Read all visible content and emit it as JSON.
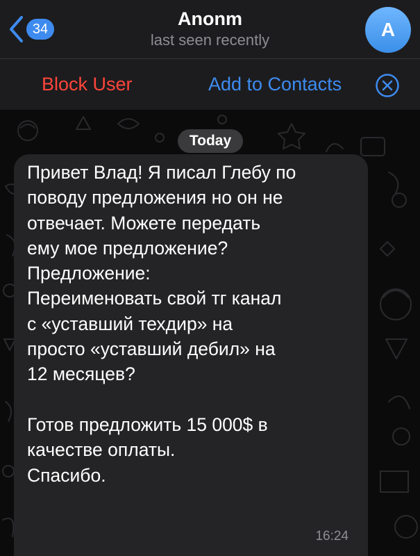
{
  "header": {
    "back_icon": "chevron-left-icon",
    "unread_count": "34",
    "title": "Anonm",
    "status": "last seen recently",
    "avatar_letter": "A"
  },
  "action_bar": {
    "block_label": "Block User",
    "add_label": "Add to Contacts",
    "close_icon": "close-circle-icon"
  },
  "chat": {
    "date_label": "Today",
    "messages": [
      {
        "text": "Привет Влад! Я писал Глебу по\nповоду предложения но он не\nотвечает. Можете передать\nему мое предложение?\nПредложение:\nПереименовать свой тг канал\nс «уставший техдир» на\nпросто «уставший дебил» на\n12 месяцев?\n\nГотов предложить 15 000$ в\nкачестве оплаты.\nСпасибо.",
        "time": "16:24"
      }
    ]
  },
  "colors": {
    "accent": "#3e8bf0",
    "danger": "#ff453a",
    "header_bg": "#1c1c1e",
    "bubble_bg": "#242426",
    "secondary_text": "#8d8d93"
  }
}
